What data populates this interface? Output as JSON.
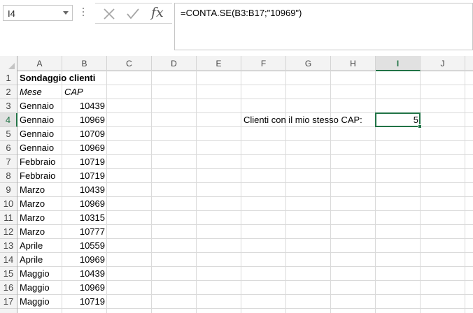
{
  "name_box": {
    "value": "I4"
  },
  "formula_bar": {
    "fx_label": "fx",
    "formula": "=CONTA.SE(B3:B17;\"10969\")"
  },
  "columns": [
    "A",
    "B",
    "C",
    "D",
    "E",
    "F",
    "G",
    "H",
    "I",
    "J"
  ],
  "selected_column": "I",
  "rows": [
    "1",
    "2",
    "3",
    "4",
    "5",
    "6",
    "7",
    "8",
    "9",
    "10",
    "11",
    "12",
    "13",
    "14",
    "15",
    "16",
    "17"
  ],
  "selected_row": "4",
  "sheet": {
    "title": "Sondaggio clienti",
    "header_month": "Mese",
    "header_cap": "CAP",
    "records": [
      {
        "mese": "Gennaio",
        "cap": "10439"
      },
      {
        "mese": "Gennaio",
        "cap": "10969"
      },
      {
        "mese": "Gennaio",
        "cap": "10709"
      },
      {
        "mese": "Gennaio",
        "cap": "10969"
      },
      {
        "mese": "Febbraio",
        "cap": "10719"
      },
      {
        "mese": "Febbraio",
        "cap": "10719"
      },
      {
        "mese": "Marzo",
        "cap": "10439"
      },
      {
        "mese": "Marzo",
        "cap": "10969"
      },
      {
        "mese": "Marzo",
        "cap": "10315"
      },
      {
        "mese": "Marzo",
        "cap": "10777"
      },
      {
        "mese": "Aprile",
        "cap": "10559"
      },
      {
        "mese": "Aprile",
        "cap": "10969"
      },
      {
        "mese": "Maggio",
        "cap": "10439"
      },
      {
        "mese": "Maggio",
        "cap": "10969"
      },
      {
        "mese": "Maggio",
        "cap": "10719"
      }
    ],
    "label_f4": "Clienti con il mio stesso CAP:",
    "result_i4": "5"
  },
  "colors": {
    "accent": "#217346",
    "gridline": "#dadada",
    "header_bg": "#f3f3f3"
  }
}
